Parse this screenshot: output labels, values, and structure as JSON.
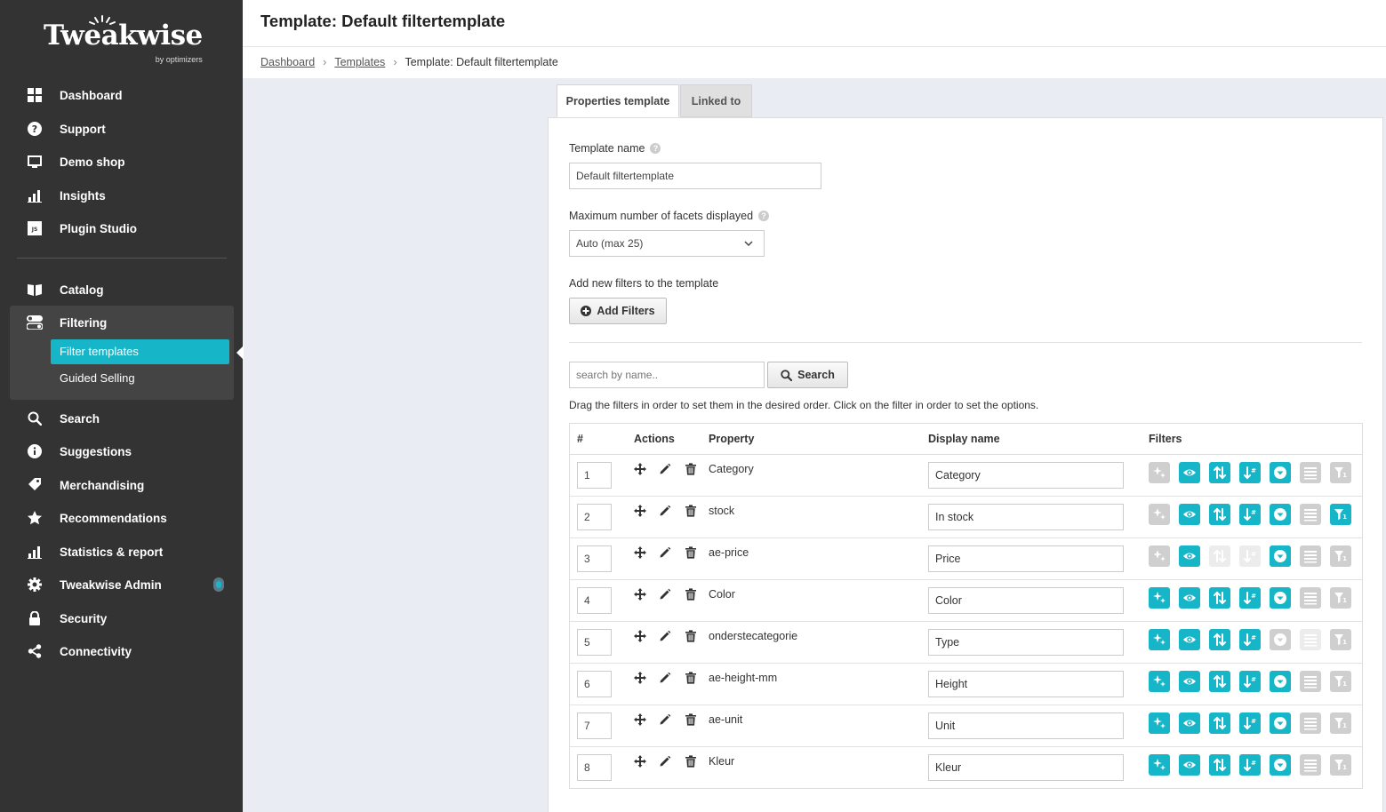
{
  "brand": {
    "name": "Tweakwise",
    "tagline": "by optimizers"
  },
  "nav": {
    "items": [
      {
        "label": "Dashboard",
        "icon": "dashboard-icon"
      },
      {
        "label": "Support",
        "icon": "question-icon"
      },
      {
        "label": "Demo shop",
        "icon": "monitor-icon"
      },
      {
        "label": "Insights",
        "icon": "bar-chart-icon"
      },
      {
        "label": "Plugin Studio",
        "icon": "js-icon"
      },
      {
        "label": "Catalog",
        "icon": "book-icon"
      },
      {
        "label": "Filtering",
        "icon": "toggle-icon"
      },
      {
        "label": "Search",
        "icon": "search-icon"
      },
      {
        "label": "Suggestions",
        "icon": "info-icon"
      },
      {
        "label": "Merchandising",
        "icon": "tag-icon"
      },
      {
        "label": "Recommendations",
        "icon": "star-icon"
      },
      {
        "label": "Statistics & report",
        "icon": "stats-icon"
      },
      {
        "label": "Tweakwise Admin",
        "icon": "gear-icon"
      },
      {
        "label": "Security",
        "icon": "lock-icon"
      },
      {
        "label": "Connectivity",
        "icon": "share-icon"
      }
    ],
    "sub_items": [
      {
        "label": "Filter templates",
        "active": true
      },
      {
        "label": "Guided Selling",
        "active": false
      }
    ]
  },
  "header": {
    "title": "Template: Default filtertemplate",
    "breadcrumb": [
      "Dashboard",
      "Templates",
      "Template: Default filtertemplate"
    ]
  },
  "tabs": [
    "Properties template",
    "Linked to"
  ],
  "form": {
    "template_name_label": "Template name",
    "template_name_value": "Default filtertemplate",
    "max_facets_label": "Maximum number of facets displayed",
    "max_facets_value": "Auto (max 25)",
    "add_filters_label": "Add new filters to the template",
    "add_filters_button": "Add Filters",
    "search_placeholder": "search by name..",
    "search_button": "Search",
    "hint": "Drag the filters in order to set them in the desired order. Click on the filter in order to set the options."
  },
  "table": {
    "headers": [
      "#",
      "Actions",
      "Property",
      "Display name",
      "Filters"
    ],
    "filter_icons": [
      "sparkle-icon",
      "eye-icon",
      "sort-icon",
      "sort-numeric-icon",
      "chevron-down-circle-icon",
      "list-icon",
      "filter-icon"
    ],
    "rows": [
      {
        "num": "1",
        "property": "Category",
        "display": "Category",
        "filters": [
          "off",
          "on",
          "on",
          "on",
          "on",
          "off",
          "off"
        ]
      },
      {
        "num": "2",
        "property": "stock",
        "display": "In stock",
        "filters": [
          "off",
          "on",
          "on",
          "on",
          "on",
          "off",
          "on"
        ]
      },
      {
        "num": "3",
        "property": "ae-price",
        "display": "Price",
        "filters": [
          "off",
          "on",
          "faint",
          "faint",
          "on",
          "off",
          "off"
        ]
      },
      {
        "num": "4",
        "property": "Color",
        "display": "Color",
        "filters": [
          "on",
          "on",
          "on",
          "on",
          "on",
          "off",
          "off"
        ]
      },
      {
        "num": "5",
        "property": "onderstecategorie",
        "display": "Type",
        "filters": [
          "on",
          "on",
          "on",
          "on",
          "off",
          "faint",
          "off"
        ]
      },
      {
        "num": "6",
        "property": "ae-height-mm",
        "display": "Height",
        "filters": [
          "on",
          "on",
          "on",
          "on",
          "on",
          "off",
          "off"
        ]
      },
      {
        "num": "7",
        "property": "ae-unit",
        "display": "Unit",
        "filters": [
          "on",
          "on",
          "on",
          "on",
          "on",
          "off",
          "off"
        ]
      },
      {
        "num": "8",
        "property": "Kleur",
        "display": "Kleur",
        "filters": [
          "on",
          "on",
          "on",
          "on",
          "on",
          "off",
          "off"
        ]
      }
    ]
  },
  "colors": {
    "sidebar": "#333333",
    "accent": "#17b5c8",
    "disabled": "#cfcfcf"
  }
}
